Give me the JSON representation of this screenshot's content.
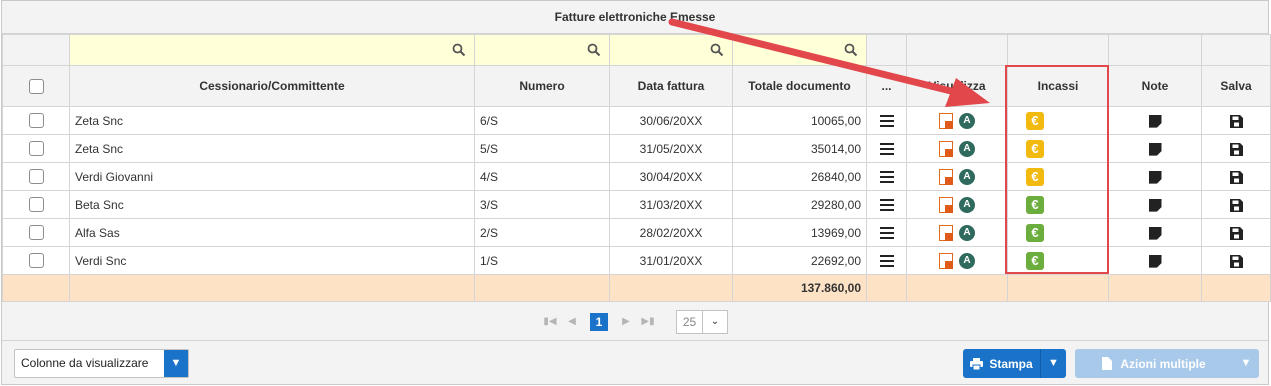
{
  "title": "Fatture elettroniche Emesse",
  "columns": {
    "cessionario": "Cessionario/Committente",
    "numero": "Numero",
    "data": "Data fattura",
    "totale": "Totale documento",
    "menu": "...",
    "visualizza": "Visualizza",
    "incassi": "Incassi",
    "note": "Note",
    "salva": "Salva"
  },
  "rows": [
    {
      "cliente": "Zeta Snc",
      "numero": "6/S",
      "data": "30/06/20XX",
      "totale": "10065,00",
      "incasso_color": "#f2b90f"
    },
    {
      "cliente": "Zeta Snc",
      "numero": "5/S",
      "data": "31/05/20XX",
      "totale": "35014,00",
      "incasso_color": "#f2b90f"
    },
    {
      "cliente": "Verdi Giovanni",
      "numero": "4/S",
      "data": "30/04/20XX",
      "totale": "26840,00",
      "incasso_color": "#f2b90f"
    },
    {
      "cliente": "Beta Snc",
      "numero": "3/S",
      "data": "31/03/20XX",
      "totale": "29280,00",
      "incasso_color": "#6cae3e"
    },
    {
      "cliente": "Alfa Sas",
      "numero": "2/S",
      "data": "28/02/20XX",
      "totale": "13969,00",
      "incasso_color": "#6cae3e"
    },
    {
      "cliente": "Verdi Snc",
      "numero": "1/S",
      "data": "31/01/20XX",
      "totale": "22692,00",
      "incasso_color": "#6cae3e"
    }
  ],
  "total": "137.860,00",
  "pager": {
    "current": "1",
    "page_size": "25"
  },
  "footer": {
    "columns_button": "Colonne da visualizzare",
    "stampa": "Stampa",
    "azioni": "Azioni multiple"
  },
  "icons": {
    "search": "search-icon",
    "menu": "hamburger-icon",
    "pdf": "pdf-icon",
    "ade": "agenzia-entrate-icon",
    "euro": "euro-icon",
    "note": "note-icon",
    "save": "save-icon",
    "print": "print-icon"
  },
  "colors": {
    "accent": "#1a73c8",
    "filter_bg": "#ffffd8",
    "total_bg": "#fde2c6",
    "annotation": "#e2474b"
  }
}
